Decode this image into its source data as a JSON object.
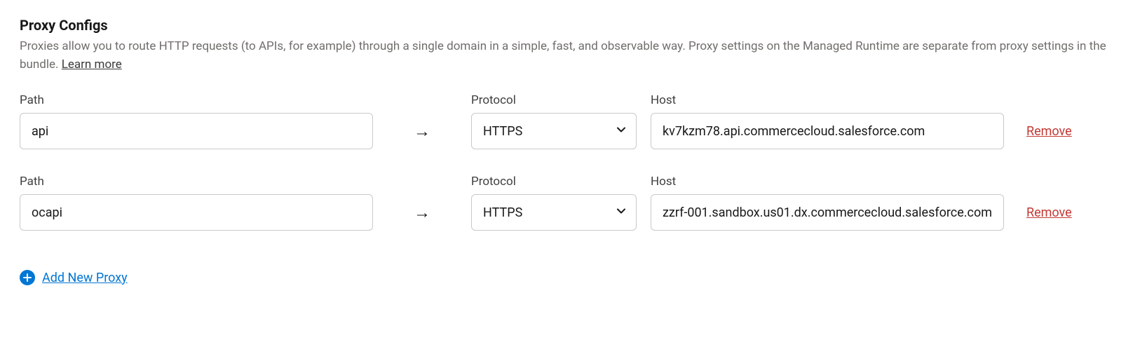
{
  "header": {
    "title": "Proxy Configs",
    "description": "Proxies allow you to route HTTP requests (to APIs, for example) through a single domain in a simple, fast, and observable way. Proxy settings on the Managed Runtime are separate from proxy settings in the bundle. ",
    "learn_more": "Learn more"
  },
  "labels": {
    "path": "Path",
    "protocol": "Protocol",
    "host": "Host",
    "remove": "Remove",
    "add_new_proxy": "Add New Proxy",
    "arrow": "→"
  },
  "proxies": [
    {
      "path": "api",
      "protocol": "HTTPS",
      "host": "kv7kzm78.api.commercecloud.salesforce.com"
    },
    {
      "path": "ocapi",
      "protocol": "HTTPS",
      "host": "zzrf-001.sandbox.us01.dx.commercecloud.salesforce.com"
    }
  ]
}
